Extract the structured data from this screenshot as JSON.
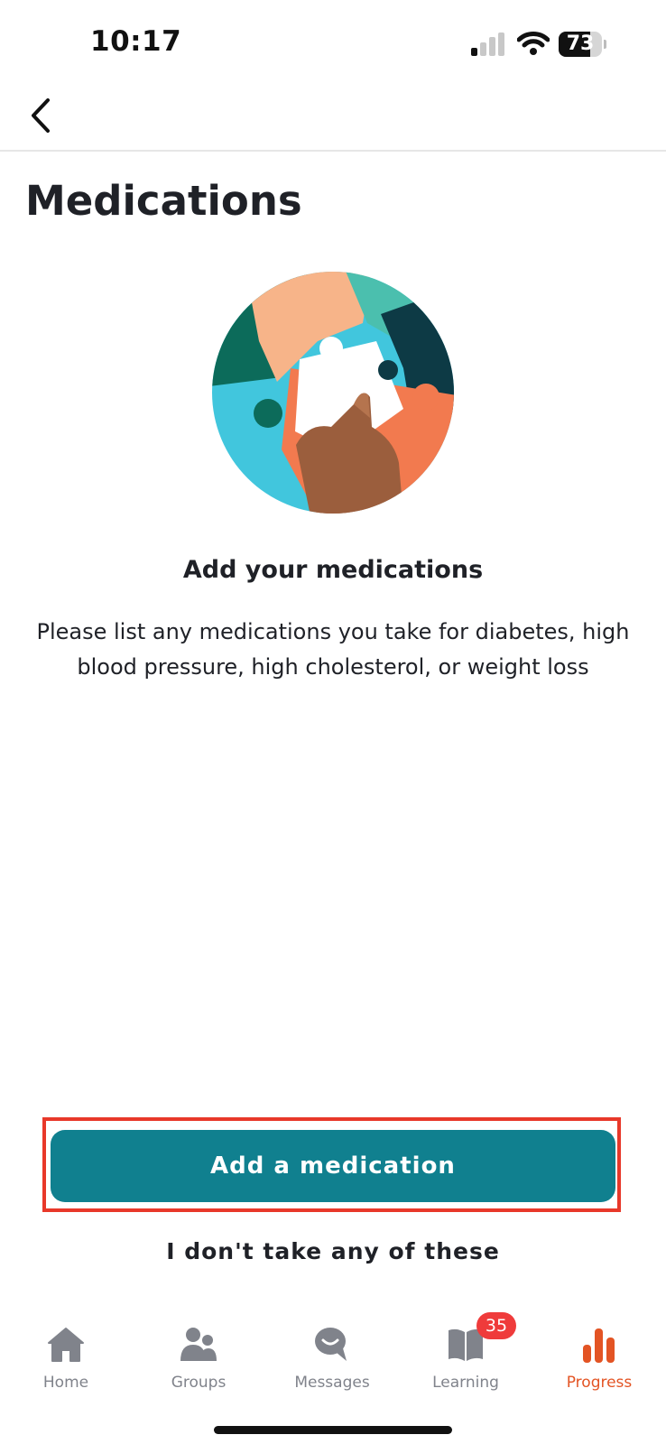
{
  "status_bar": {
    "time": "10:17",
    "battery_level": 73,
    "battery_label": "73",
    "signal_icon": "cellular-signal-icon",
    "wifi_icon": "wifi-icon"
  },
  "nav": {
    "back_icon": "chevron-left-icon"
  },
  "page": {
    "title": "Medications",
    "illustration": "puzzle-hand-illustration",
    "heading": "Add your medications",
    "description": "Please list any medications you take for diabetes, high blood pressure, high cholesterol, or weight loss"
  },
  "actions": {
    "primary_label": "Add a medication",
    "secondary_label": "I don't take any of these"
  },
  "tab_bar": {
    "items": [
      {
        "label": "Home",
        "icon": "home-icon"
      },
      {
        "label": "Groups",
        "icon": "groups-icon"
      },
      {
        "label": "Messages",
        "icon": "messages-icon"
      },
      {
        "label": "Learning",
        "icon": "book-icon",
        "badge": "35"
      },
      {
        "label": "Progress",
        "icon": "bar-chart-icon",
        "active": true
      }
    ]
  },
  "colors": {
    "primary_button": "#10808f",
    "active_tab": "#e35424",
    "inactive_tab": "#80838b",
    "badge": "#ef3b3b",
    "highlight": "#e8382a"
  }
}
